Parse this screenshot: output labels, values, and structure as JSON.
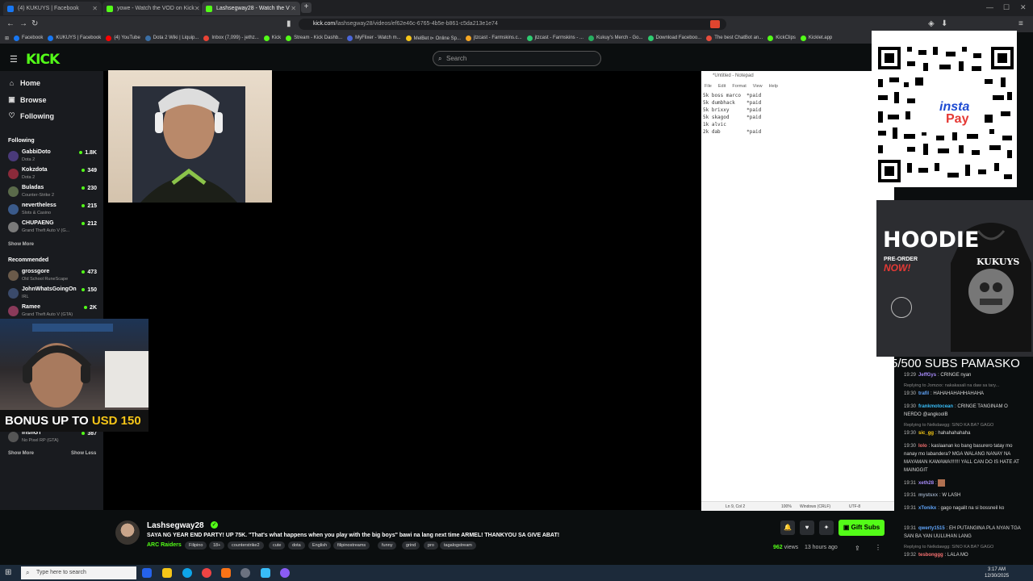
{
  "browser": {
    "tabs": [
      {
        "label": "(4) KUKUYS | Facebook",
        "favicon_color": "#1877f2"
      },
      {
        "label": "yowe - Watch the VOD on Kick",
        "favicon_color": "#53fc18"
      },
      {
        "label": "Lashsegway28 - Watch the V",
        "favicon_color": "#53fc18",
        "active": true
      }
    ],
    "url_domain": "kick.com",
    "url_path": "/lashsegway28/videos/ef62e46c-6765-4b5e-b861-c5da213e1e74",
    "bookmarks": [
      {
        "label": "Facebook",
        "color": "#1877f2"
      },
      {
        "label": "KUKUYS | Facebook",
        "color": "#1877f2"
      },
      {
        "label": "(4) YouTube",
        "color": "#ff0000"
      },
      {
        "label": "Dota 2 Wiki | Liquip...",
        "color": "#3a6ea5"
      },
      {
        "label": "Inbox (7,099) - jethz...",
        "color": "#ea4335"
      },
      {
        "label": "Kick",
        "color": "#53fc18"
      },
      {
        "label": "Stream - Kick Dashb...",
        "color": "#53fc18"
      },
      {
        "label": "MyFlixer - Watch m...",
        "color": "#4a66d9"
      },
      {
        "label": "MelBet ⊳ Online Sp...",
        "color": "#f5c518"
      },
      {
        "label": "jtzcast - Farmskins.c...",
        "color": "#f5a623"
      },
      {
        "label": "jtzcast - Farmskins - ...",
        "color": "#2ecc71"
      },
      {
        "label": "Kukuy's Merch - Go...",
        "color": "#27ae60"
      },
      {
        "label": "Download Faceboo...",
        "color": "#2ecc71"
      },
      {
        "label": "The best ChatBot an...",
        "color": "#e74c3c"
      },
      {
        "label": "KickClips",
        "color": "#53fc18"
      },
      {
        "label": "Kicklet.app",
        "color": "#53fc18"
      }
    ]
  },
  "kick": {
    "logo": "KICK",
    "search_placeholder": "Search"
  },
  "sidebar": {
    "nav": [
      {
        "label": "Home",
        "icon": "home-icon",
        "glyph": "⌂"
      },
      {
        "label": "Browse",
        "icon": "browse-icon",
        "glyph": "▣"
      },
      {
        "label": "Following",
        "icon": "heart-icon",
        "glyph": "♡"
      }
    ],
    "following_header": "Following",
    "following": [
      {
        "name": "GabbiDoto",
        "game": "Dota 2",
        "viewers": "1.8K",
        "color": "#4a3a7a"
      },
      {
        "name": "Kokzdota",
        "game": "Dota 2",
        "viewers": "349",
        "color": "#8a2a3a"
      },
      {
        "name": "Buladas",
        "game": "Counter-Strike 2",
        "viewers": "230",
        "color": "#5a6a4a"
      },
      {
        "name": "nevertheless",
        "game": "Slots & Casino",
        "viewers": "215",
        "color": "#3a5a8a"
      },
      {
        "name": "CHUPAENG",
        "game": "Grand Theft Auto V (G...",
        "viewers": "212",
        "color": "#7a7a7a"
      }
    ],
    "show_more_1": "Show More",
    "recommended_header": "Recommended",
    "recommended": [
      {
        "name": "grossgore",
        "game": "Old School RuneScape",
        "viewers": "473",
        "color": "#6a5a4a"
      },
      {
        "name": "JohnWhatsGoingOn",
        "game": "IRL",
        "viewers": "150",
        "color": "#3a4a6a"
      },
      {
        "name": "Ramee",
        "game": "Grand Theft Auto V (GTA)",
        "viewers": "2K",
        "color": "#8a3a5a"
      }
    ],
    "last_item": {
      "name": "irishGT",
      "game": "No Pixel RP (GTA)",
      "viewers": "387"
    },
    "show_more_2": "Show More",
    "show_less": "Show Less"
  },
  "overlays": {
    "bonus_text": "BONUS UP TO",
    "bonus_amount": "USD 150",
    "hoodie_title": "HOODIE",
    "hoodie_pre": "PRE-ORDER",
    "hoodie_now": "NOW!",
    "hoodie_brand": "KUKUYS",
    "qr_label_1": "insta",
    "qr_label_2": "Pay",
    "subs_goal": "5/500 SUBS PAMASKO"
  },
  "notepad": {
    "title": "*Untitled - Notepad",
    "menu": [
      "File",
      "Edit",
      "Format",
      "View",
      "Help"
    ],
    "lines": [
      "5k boss marco  *paid",
      "5k dumbhack    *paid",
      "5k brixxy      *paid",
      "5k skagod      *paid",
      "1k alvic",
      "2k dab         *paid"
    ],
    "status_pos": "Ln 9, Col 2",
    "status_zoom": "100%",
    "status_eol": "Windows (CRLF)",
    "status_enc": "UTF-8"
  },
  "chat": [
    {
      "kind": "msg",
      "time": "19:29",
      "user": "JeffGys",
      "color": "#a78bfa",
      "text": "CRINGE nyan"
    },
    {
      "kind": "reply",
      "text": "Replying to Jomzxx: nakakasali na daw sa tary..."
    },
    {
      "kind": "msg",
      "time": "19:30",
      "user": "trafil",
      "color": "#60a5fa",
      "text": "HAHAHAHAHHAHAHA"
    },
    {
      "kind": "msg",
      "time": "19:30",
      "user": "frankmotocean",
      "color": "#38bdf8",
      "text": "CRINGE TANGINAM O NERDO @angkoolB"
    },
    {
      "kind": "reply",
      "text": "Replying to Nelkdawgg: SINO KA BA? GAGO"
    },
    {
      "kind": "msg",
      "time": "19:30",
      "user": "sic_gg",
      "color": "#facc15",
      "text": "hahahahahaha"
    },
    {
      "kind": "msg",
      "time": "19:30",
      "user": "lolo",
      "color": "#f87171",
      "text": "kaslaanan ko bang basurero tatay mo nanay mo labandera? MGA WALANG NANAY NA MAYAMAN KAWAWA!!!!!!! YALL CAN DO IS HATE AT MAINGGIT"
    },
    {
      "kind": "msg",
      "time": "19:31",
      "user": "xeth28",
      "color": "#a78bfa",
      "text": ""
    },
    {
      "kind": "msg",
      "time": "19:31",
      "user": "mystsxx",
      "color": "#94a3b8",
      "text": "W LASH"
    },
    {
      "kind": "msg",
      "time": "19:31",
      "user": "xTonikx",
      "color": "#60a5fa",
      "text": "gago nagalit na si bossneil ko"
    },
    {
      "kind": "msg",
      "time": "19:31",
      "user": "qwerty1515",
      "color": "#60a5fa",
      "text": "EH PUTANGINA PLA NYAN TGA SAN BA YAN UULUHAN LANG"
    },
    {
      "kind": "reply",
      "text": "Replying to Nelkdawgg: SINO KA BA? GAGO"
    },
    {
      "kind": "msg",
      "time": "19:32",
      "user": "tesbonggg",
      "color": "#f87171",
      "text": "LALA MO"
    }
  ],
  "stream": {
    "channel": "Lashsegway28",
    "title": "SAYA NG YEAR END PARTY! UP 75K. \"That's what happens when you play with the big boys\" bawi na lang next time ARMEL! THANKYOU SA GIVE ABAT!",
    "category": "ARC Raiders",
    "tags": [
      "Filipino",
      "18+",
      "counterstrike2",
      "cute",
      "dota",
      "English",
      "filipinostreams",
      "funny",
      "grind",
      "pro",
      "tagalogstream"
    ],
    "gift_subs": "Gift Subs",
    "views_count": "962",
    "views_label": "views",
    "ago": "13 hours ago"
  },
  "taskbar": {
    "search_placeholder": "Type here to search",
    "time": "3:17 AM",
    "date": "12/30/2025"
  }
}
